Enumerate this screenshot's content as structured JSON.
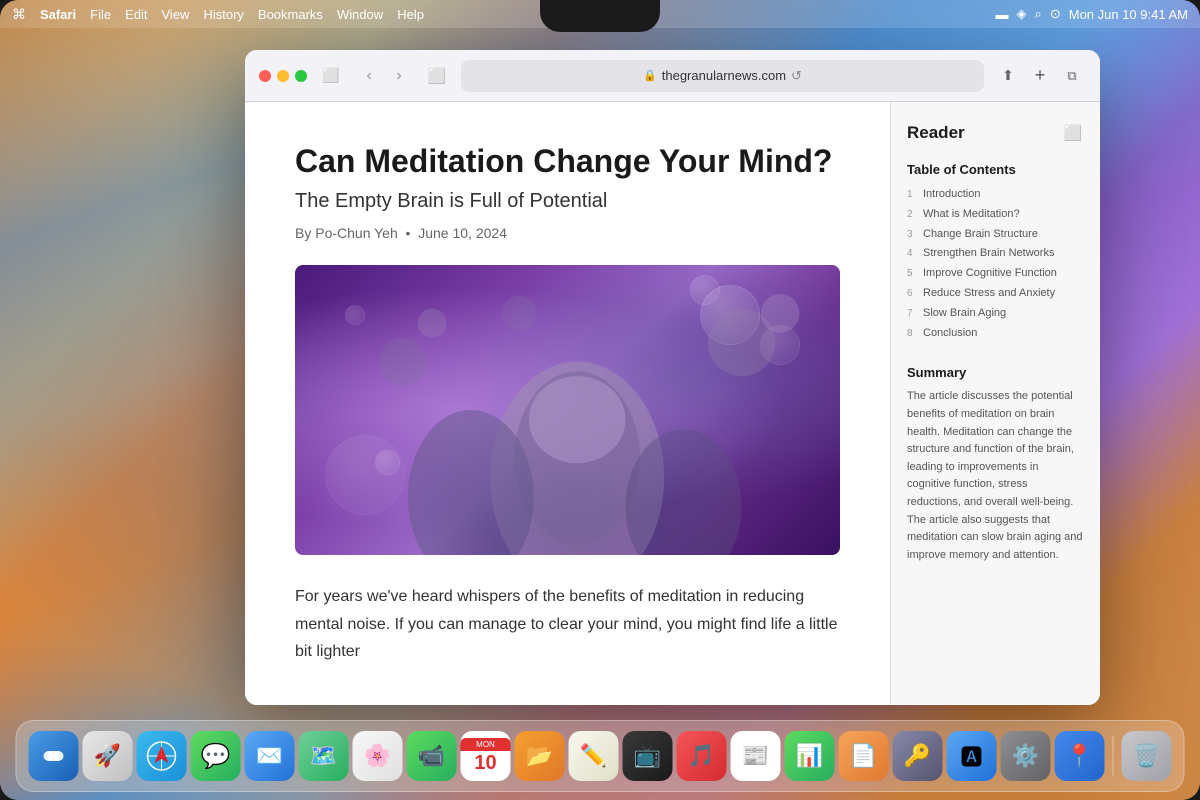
{
  "system": {
    "date": "Mon Jun 10",
    "time": "9:41 AM"
  },
  "menu_bar": {
    "apple": "⌘",
    "items": [
      "Safari",
      "File",
      "Edit",
      "View",
      "History",
      "Bookmarks",
      "Window",
      "Help"
    ]
  },
  "safari": {
    "url": "thegranularnews.com",
    "toolbar": {
      "back_label": "‹",
      "forward_label": "›",
      "share_label": "↑",
      "new_tab_label": "+",
      "tabs_label": "⧉",
      "sidebar_label": "⬜",
      "reload_label": "↺"
    }
  },
  "article": {
    "title": "Can Meditation Change Your Mind?",
    "subtitle": "The Empty Brain is Full of Potential",
    "author": "By Po-Chun Yeh",
    "date": "June 10, 2024",
    "body": "For years we've heard whispers of the benefits of meditation in reducing mental noise. If you can manage to clear your mind, you might find life a little bit lighter"
  },
  "reader": {
    "title": "Reader",
    "toc_title": "Table of Contents",
    "toc_items": [
      {
        "num": "1",
        "text": "Introduction"
      },
      {
        "num": "2",
        "text": "What is Meditation?"
      },
      {
        "num": "3",
        "text": "Change Brain Structure"
      },
      {
        "num": "4",
        "text": "Strengthen Brain Networks"
      },
      {
        "num": "5",
        "text": "Improve Cognitive Function"
      },
      {
        "num": "6",
        "text": "Reduce Stress and Anxiety"
      },
      {
        "num": "7",
        "text": "Slow Brain Aging"
      },
      {
        "num": "8",
        "text": "Conclusion"
      }
    ],
    "summary_title": "Summary",
    "summary_text": "The article discusses the potential benefits of meditation on brain health. Meditation can change the structure and function of the brain, leading to improvements in cognitive function, stress reductions, and overall well-being. The article also suggests that meditation can slow brain aging and improve memory and attention."
  },
  "dock": {
    "icons": [
      {
        "name": "finder",
        "emoji": "🔵",
        "label": "Finder"
      },
      {
        "name": "launchpad",
        "emoji": "🚀",
        "label": "Launchpad"
      },
      {
        "name": "safari",
        "emoji": "🧭",
        "label": "Safari"
      },
      {
        "name": "messages",
        "emoji": "💬",
        "label": "Messages"
      },
      {
        "name": "mail",
        "emoji": "✉️",
        "label": "Mail"
      },
      {
        "name": "maps",
        "emoji": "🗺️",
        "label": "Maps"
      },
      {
        "name": "photos",
        "emoji": "🌅",
        "label": "Photos"
      },
      {
        "name": "facetime",
        "emoji": "📹",
        "label": "FaceTime"
      },
      {
        "name": "calendar",
        "emoji": "📅",
        "label": "Calendar"
      },
      {
        "name": "music",
        "emoji": "🎵",
        "label": "Music"
      },
      {
        "name": "freeform",
        "emoji": "✏️",
        "label": "Freeform"
      },
      {
        "name": "appletv",
        "emoji": "📺",
        "label": "Apple TV"
      },
      {
        "name": "news",
        "emoji": "📰",
        "label": "News"
      },
      {
        "name": "files",
        "emoji": "📁",
        "label": "Files"
      },
      {
        "name": "numbers",
        "emoji": "📊",
        "label": "Numbers"
      },
      {
        "name": "pages",
        "emoji": "📄",
        "label": "Pages"
      },
      {
        "name": "passwords",
        "emoji": "🔑",
        "label": "Passwords"
      },
      {
        "name": "appstore",
        "emoji": "🅰️",
        "label": "App Store"
      },
      {
        "name": "settings",
        "emoji": "⚙️",
        "label": "System Settings"
      },
      {
        "name": "findmy",
        "emoji": "📍",
        "label": "Find My"
      },
      {
        "name": "trash",
        "emoji": "🗑️",
        "label": "Trash"
      }
    ]
  }
}
